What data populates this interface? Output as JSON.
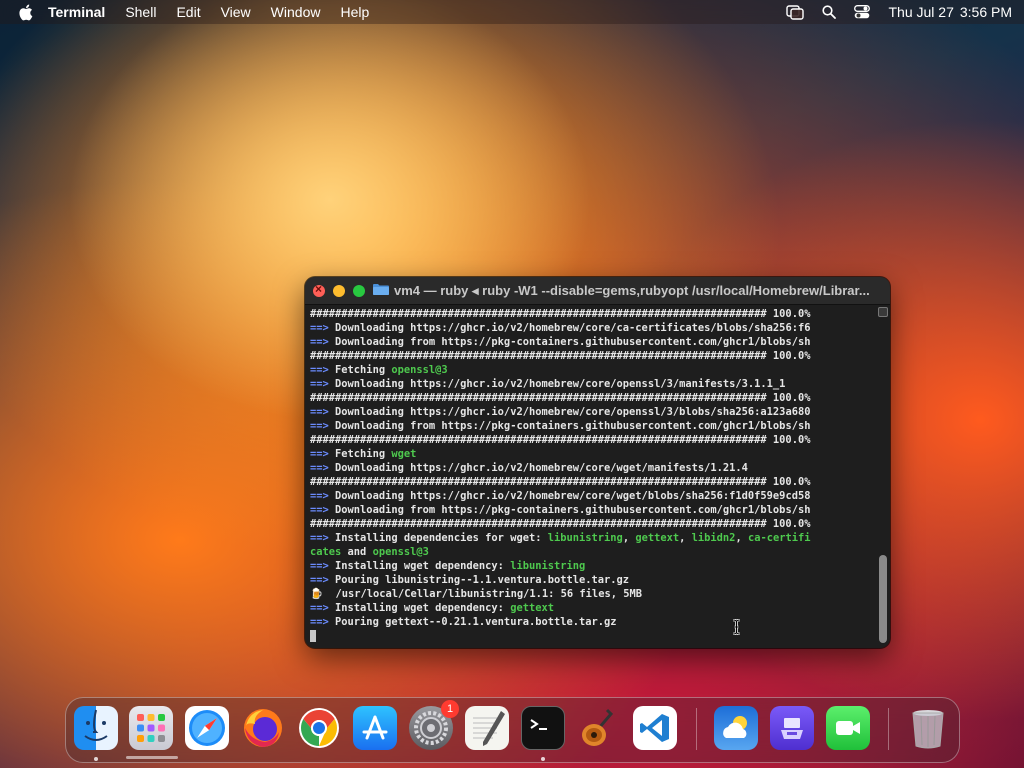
{
  "menubar": {
    "app_name": "Terminal",
    "items": [
      "Shell",
      "Edit",
      "View",
      "Window",
      "Help"
    ],
    "date": "Thu Jul 27",
    "time": "3:56 PM"
  },
  "window": {
    "title": "vm4 — ruby ◂ ruby -W1 --disable=gems,rubyopt /usr/local/Homebrew/Librar..."
  },
  "terminal": {
    "lines": [
      {
        "parts": [
          {
            "t": "######################################################################### 100.0%",
            "c": ""
          }
        ]
      },
      {
        "parts": [
          {
            "t": "==> ",
            "c": "arrow"
          },
          {
            "t": "Downloading https://ghcr.io/v2/homebrew/core/ca-certificates/blobs/sha256:f6",
            "c": ""
          }
        ]
      },
      {
        "parts": [
          {
            "t": "==> ",
            "c": "arrow"
          },
          {
            "t": "Downloading from https://pkg-containers.githubusercontent.com/ghcr1/blobs/sh",
            "c": ""
          }
        ]
      },
      {
        "parts": [
          {
            "t": "######################################################################### 100.0%",
            "c": ""
          }
        ]
      },
      {
        "parts": [
          {
            "t": "==> ",
            "c": "arrow"
          },
          {
            "t": "Fetching ",
            "c": ""
          },
          {
            "t": "openssl@3",
            "c": "green"
          }
        ]
      },
      {
        "parts": [
          {
            "t": "==> ",
            "c": "arrow"
          },
          {
            "t": "Downloading https://ghcr.io/v2/homebrew/core/openssl/3/manifests/3.1.1_1",
            "c": ""
          }
        ]
      },
      {
        "parts": [
          {
            "t": "######################################################################### 100.0%",
            "c": ""
          }
        ]
      },
      {
        "parts": [
          {
            "t": "==> ",
            "c": "arrow"
          },
          {
            "t": "Downloading https://ghcr.io/v2/homebrew/core/openssl/3/blobs/sha256:a123a680",
            "c": ""
          }
        ]
      },
      {
        "parts": [
          {
            "t": "==> ",
            "c": "arrow"
          },
          {
            "t": "Downloading from https://pkg-containers.githubusercontent.com/ghcr1/blobs/sh",
            "c": ""
          }
        ]
      },
      {
        "parts": [
          {
            "t": "######################################################################### 100.0%",
            "c": ""
          }
        ]
      },
      {
        "parts": [
          {
            "t": "==> ",
            "c": "arrow"
          },
          {
            "t": "Fetching ",
            "c": ""
          },
          {
            "t": "wget",
            "c": "green"
          }
        ]
      },
      {
        "parts": [
          {
            "t": "==> ",
            "c": "arrow"
          },
          {
            "t": "Downloading https://ghcr.io/v2/homebrew/core/wget/manifests/1.21.4",
            "c": ""
          }
        ]
      },
      {
        "parts": [
          {
            "t": "######################################################################### 100.0%",
            "c": ""
          }
        ]
      },
      {
        "parts": [
          {
            "t": "==> ",
            "c": "arrow"
          },
          {
            "t": "Downloading https://ghcr.io/v2/homebrew/core/wget/blobs/sha256:f1d0f59e9cd58",
            "c": ""
          }
        ]
      },
      {
        "parts": [
          {
            "t": "==> ",
            "c": "arrow"
          },
          {
            "t": "Downloading from https://pkg-containers.githubusercontent.com/ghcr1/blobs/sh",
            "c": ""
          }
        ]
      },
      {
        "parts": [
          {
            "t": "######################################################################### 100.0%",
            "c": ""
          }
        ]
      },
      {
        "parts": [
          {
            "t": "==> ",
            "c": "arrow"
          },
          {
            "t": "Installing dependencies for wget: ",
            "c": ""
          },
          {
            "t": "libunistring",
            "c": "green"
          },
          {
            "t": ", ",
            "c": ""
          },
          {
            "t": "gettext",
            "c": "green"
          },
          {
            "t": ", ",
            "c": ""
          },
          {
            "t": "libidn2",
            "c": "green"
          },
          {
            "t": ", ",
            "c": ""
          },
          {
            "t": "ca-certifi",
            "c": "green"
          }
        ]
      },
      {
        "parts": [
          {
            "t": "cates",
            "c": "green"
          },
          {
            "t": " and ",
            "c": ""
          },
          {
            "t": "openssl@3",
            "c": "green"
          }
        ]
      },
      {
        "parts": [
          {
            "t": "==> ",
            "c": "arrow"
          },
          {
            "t": "Installing wget dependency: ",
            "c": ""
          },
          {
            "t": "libunistring",
            "c": "green"
          }
        ]
      },
      {
        "parts": [
          {
            "t": "==> ",
            "c": "arrow"
          },
          {
            "t": "Pouring libunistring--1.1.ventura.bottle.tar.gz",
            "c": ""
          }
        ]
      },
      {
        "parts": [
          {
            "t": "🍺  ",
            "c": ""
          },
          {
            "t": "/usr/local/Cellar/libunistring/1.1: 56 files, 5MB",
            "c": ""
          }
        ]
      },
      {
        "parts": [
          {
            "t": "==> ",
            "c": "arrow"
          },
          {
            "t": "Installing wget dependency: ",
            "c": ""
          },
          {
            "t": "gettext",
            "c": "green"
          }
        ]
      },
      {
        "parts": [
          {
            "t": "==> ",
            "c": "arrow"
          },
          {
            "t": "Pouring gettext--0.21.1.ventura.bottle.tar.gz",
            "c": ""
          }
        ]
      }
    ]
  },
  "dock": {
    "apps": [
      {
        "name": "finder-icon",
        "running": true
      },
      {
        "name": "launchpad-icon",
        "running": false
      },
      {
        "name": "safari-icon",
        "running": false
      },
      {
        "name": "firefox-icon",
        "running": false
      },
      {
        "name": "chrome-icon",
        "running": false
      },
      {
        "name": "app-store-icon",
        "running": false
      },
      {
        "name": "system-settings-icon",
        "running": false,
        "badge": "1"
      },
      {
        "name": "textedit-icon",
        "running": false
      },
      {
        "name": "terminal-icon",
        "running": true
      },
      {
        "name": "garageband-icon",
        "running": false
      },
      {
        "name": "vscode-icon",
        "running": false
      },
      {
        "name": "weather-icon",
        "running": false
      },
      {
        "name": "downloads-icon",
        "running": false
      },
      {
        "name": "facetime-icon",
        "running": false
      },
      {
        "name": "trash-icon",
        "running": false
      }
    ]
  },
  "colors": {
    "terminal_bg": "#1e1e1e",
    "arrow": "#6b8cff",
    "green": "#4ec94e"
  }
}
